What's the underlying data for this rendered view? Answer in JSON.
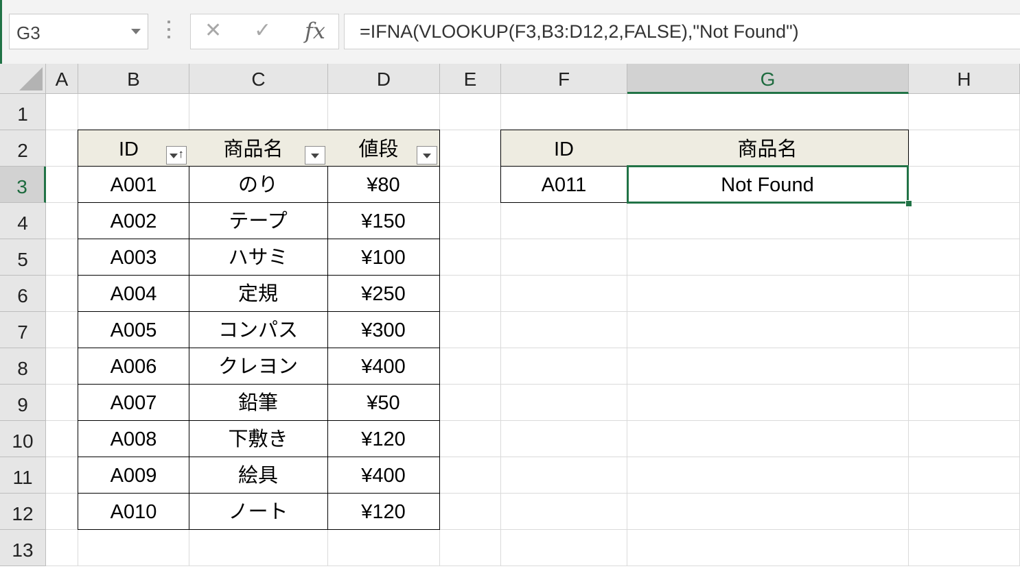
{
  "formula_bar": {
    "name_box": "G3",
    "formula": "=IFNA(VLOOKUP(F3,B3:D12,2,FALSE),\"Not Found\")",
    "cancel_icon": "✕",
    "enter_icon": "✓",
    "fx_label": "fx"
  },
  "columns": [
    "A",
    "B",
    "C",
    "D",
    "E",
    "F",
    "G",
    "H"
  ],
  "rows": [
    "1",
    "2",
    "3",
    "4",
    "5",
    "6",
    "7",
    "8",
    "9",
    "10",
    "11",
    "12",
    "13"
  ],
  "selected_cell": "G3",
  "table": {
    "headers": [
      "ID",
      "商品名",
      "値段"
    ],
    "rows": [
      [
        "A001",
        "のり",
        "¥80"
      ],
      [
        "A002",
        "テープ",
        "¥150"
      ],
      [
        "A003",
        "ハサミ",
        "¥100"
      ],
      [
        "A004",
        "定規",
        "¥250"
      ],
      [
        "A005",
        "コンパス",
        "¥300"
      ],
      [
        "A006",
        "クレヨン",
        "¥400"
      ],
      [
        "A007",
        "鉛筆",
        "¥50"
      ],
      [
        "A008",
        "下敷き",
        "¥120"
      ],
      [
        "A009",
        "絵具",
        "¥400"
      ],
      [
        "A010",
        "ノート",
        "¥120"
      ]
    ]
  },
  "lookup": {
    "headers": [
      "ID",
      "商品名"
    ],
    "id_value": "A011",
    "result_value": "Not Found"
  },
  "colors": {
    "accent_green": "#217346",
    "table_header_fill": "#eeece1"
  }
}
